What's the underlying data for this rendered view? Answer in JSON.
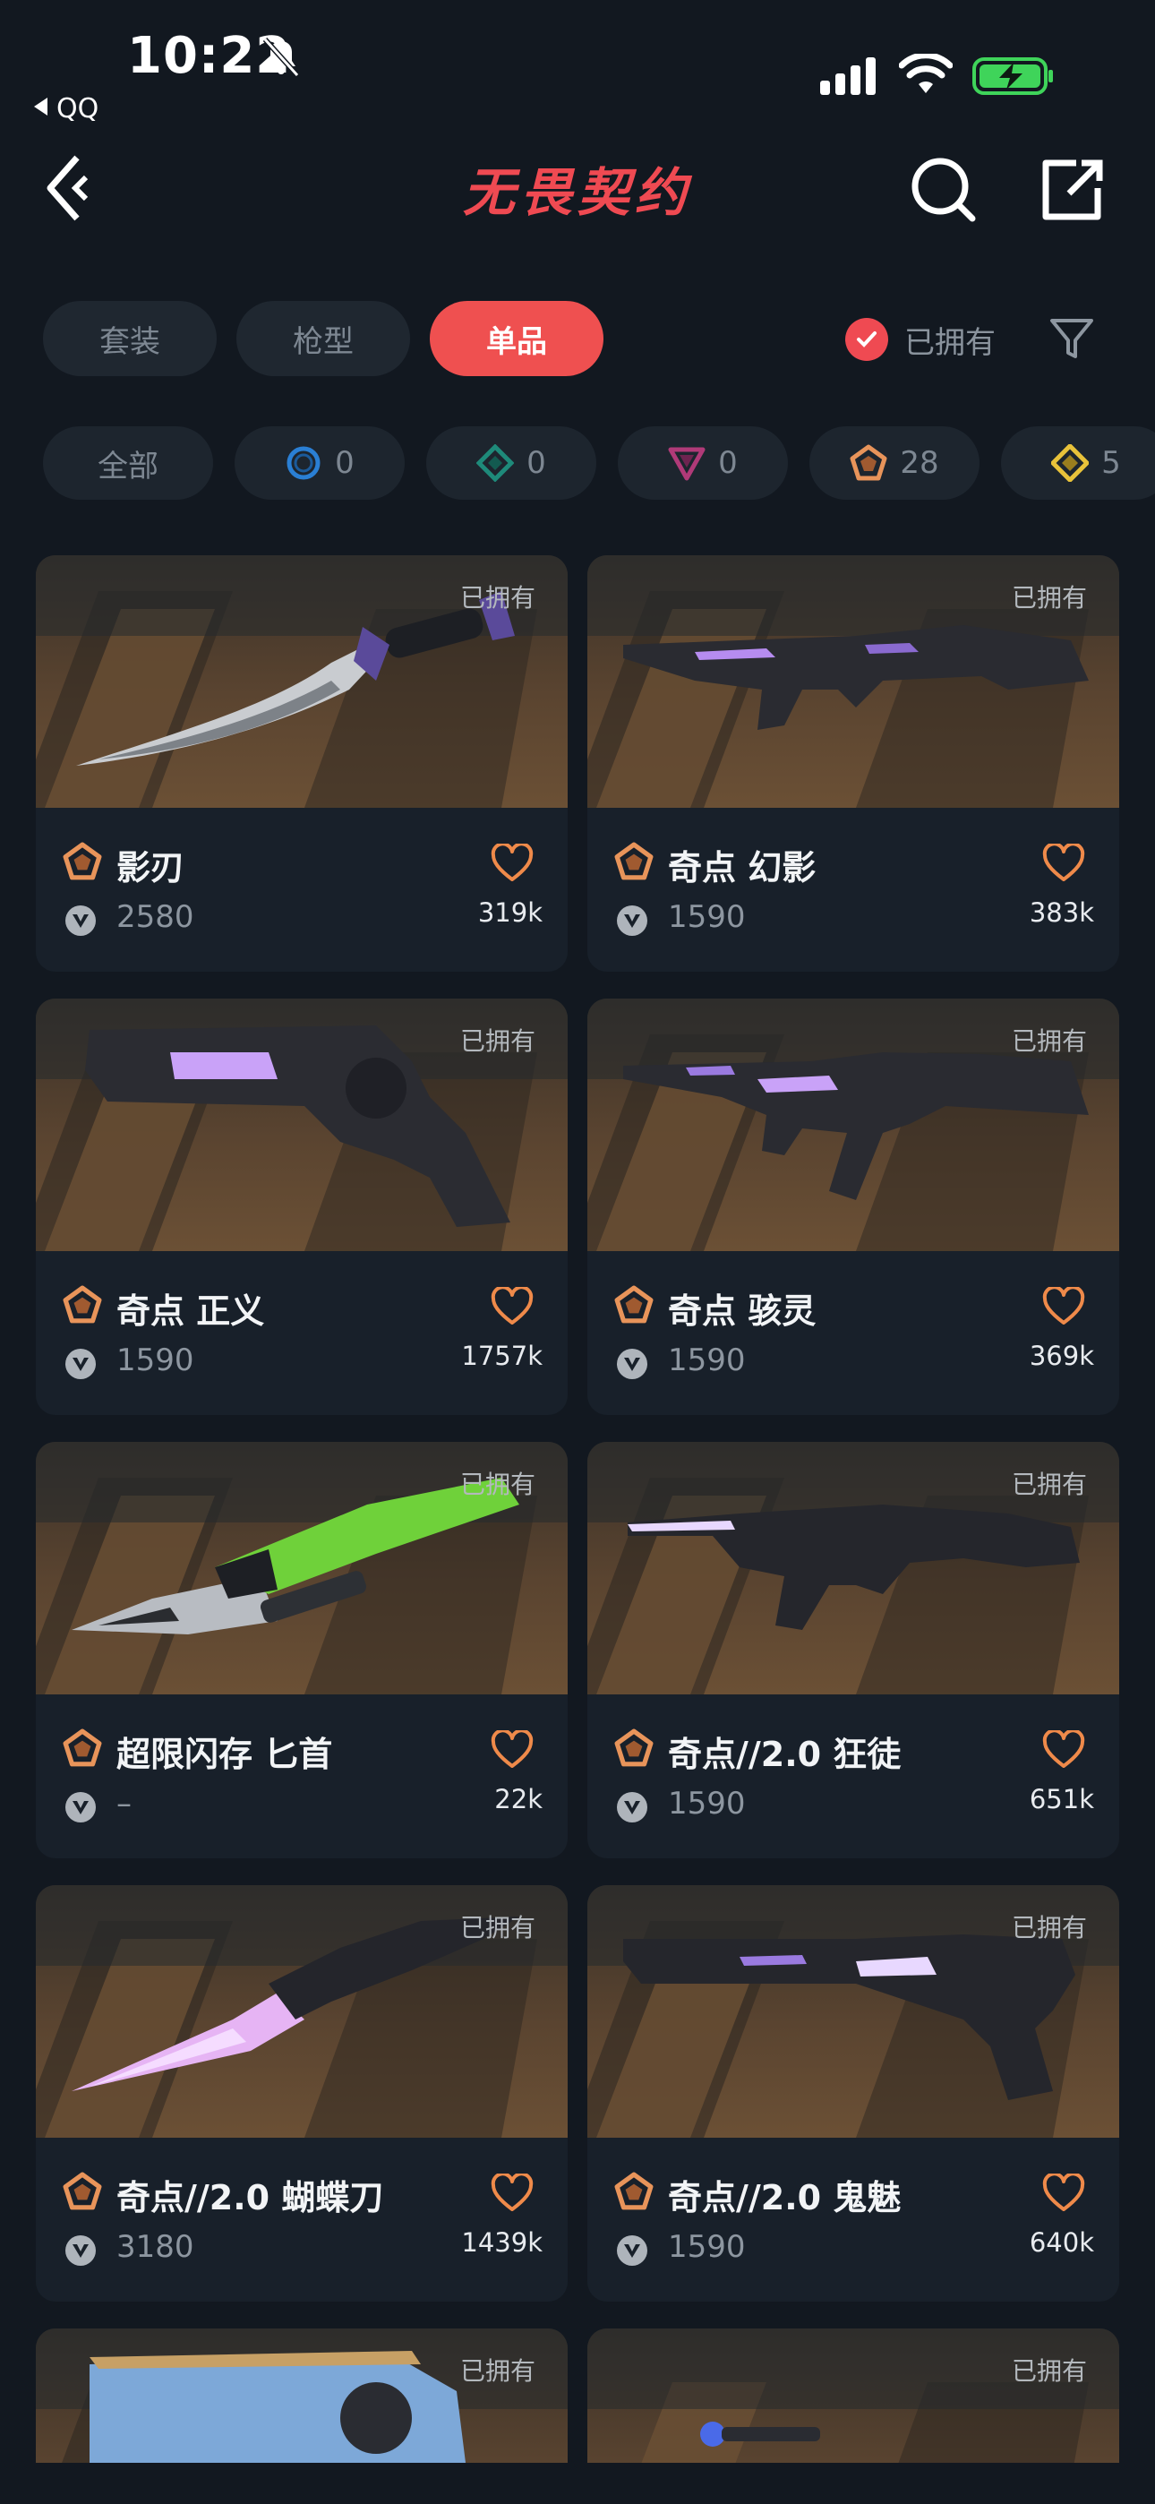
{
  "status_bar": {
    "time": "10:22",
    "back_app": "QQ"
  },
  "nav": {
    "title": "无畏契约"
  },
  "tabs": [
    {
      "label": "套装",
      "active": false
    },
    {
      "label": "枪型",
      "active": false
    },
    {
      "label": "单品",
      "active": true
    }
  ],
  "owned_filter": {
    "label": "已拥有",
    "checked": true
  },
  "rarity_chips": [
    {
      "label": "全部",
      "icon": "none"
    },
    {
      "count": "0",
      "icon": "select-tier-icon",
      "color": "#2a7fd4"
    },
    {
      "count": "0",
      "icon": "deluxe-tier-icon",
      "color": "#1e8a7a"
    },
    {
      "count": "0",
      "icon": "premium-tier-icon",
      "color": "#b03a78"
    },
    {
      "count": "28",
      "icon": "exclusive-tier-icon",
      "color": "#e8945a"
    },
    {
      "count": "5",
      "icon": "ultra-tier-icon",
      "color": "#e8c23a"
    }
  ],
  "items": [
    {
      "name": "影刃",
      "price": "2580",
      "likes": "319k",
      "owned_tag": "已拥有",
      "weapon": "knife"
    },
    {
      "name": "奇点 幻影",
      "price": "1590",
      "likes": "383k",
      "owned_tag": "已拥有",
      "weapon": "rifle"
    },
    {
      "name": "奇点 正义",
      "price": "1590",
      "likes": "1757k",
      "owned_tag": "已拥有",
      "weapon": "revolver"
    },
    {
      "name": "奇点 骇灵",
      "price": "1590",
      "likes": "369k",
      "owned_tag": "已拥有",
      "weapon": "smg"
    },
    {
      "name": "超限闪存 匕首",
      "price": "–",
      "likes": "22k",
      "owned_tag": "已拥有",
      "weapon": "green-knife"
    },
    {
      "name": "奇点//2.0 狂徒",
      "price": "1590",
      "likes": "651k",
      "owned_tag": "已拥有",
      "weapon": "rifle2"
    },
    {
      "name": "奇点//2.0 蝴蝶刀",
      "price": "3180",
      "likes": "1439k",
      "owned_tag": "已拥有",
      "weapon": "crystal-knife"
    },
    {
      "name": "奇点//2.0 鬼魅",
      "price": "1590",
      "likes": "640k",
      "owned_tag": "已拥有",
      "weapon": "pistol"
    }
  ],
  "partial_items": [
    {
      "owned_tag": "已拥有"
    },
    {
      "owned_tag": "已拥有"
    }
  ],
  "colors": {
    "accent": "#ef4a52",
    "background": "#121820",
    "card": "#18202a",
    "exclusive": "#e8945a"
  }
}
